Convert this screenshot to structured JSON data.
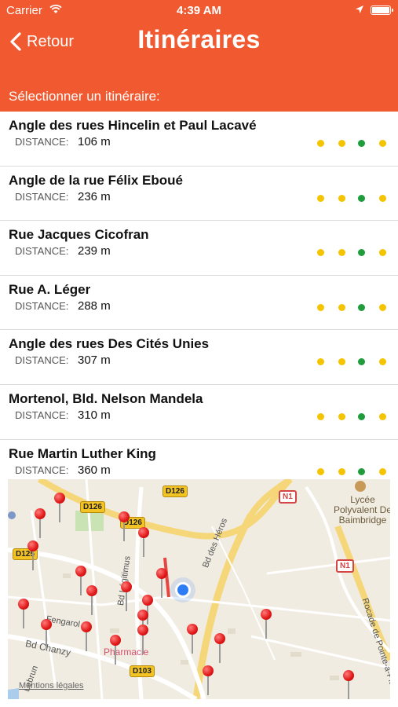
{
  "status_bar": {
    "carrier": "Carrier",
    "time": "4:39 AM"
  },
  "nav": {
    "back_label": "Retour",
    "title": "Itinéraires"
  },
  "section_label": "Sélectionner un itinéraire:",
  "list": {
    "distance_label": "DISTANCE:",
    "items": [
      {
        "title": "Angle des rues Hincelin et Paul Lacavé",
        "distance": "106 m",
        "dots": [
          "#f5c400",
          "#f5c400",
          "#1f9d3a",
          "#f5c400"
        ]
      },
      {
        "title": "Angle de la rue Félix Eboué",
        "distance": "236 m",
        "dots": [
          "#f5c400",
          "#f5c400",
          "#1f9d3a",
          "#f5c400"
        ]
      },
      {
        "title": "Rue Jacques Cicofran",
        "distance": "239 m",
        "dots": [
          "#f5c400",
          "#f5c400",
          "#1f9d3a",
          "#f5c400"
        ]
      },
      {
        "title": "Rue A. Léger",
        "distance": "288 m",
        "dots": [
          "#f5c400",
          "#f5c400",
          "#1f9d3a",
          "#f5c400"
        ]
      },
      {
        "title": "Angle des rues Des Cités Unies",
        "distance": "307 m",
        "dots": [
          "#f5c400",
          "#f5c400",
          "#1f9d3a",
          "#f5c400"
        ]
      },
      {
        "title": "Mortenol, Bld. Nelson Mandela",
        "distance": "310 m",
        "dots": [
          "#f5c400",
          "#f5c400",
          "#1f9d3a",
          "#f5c400"
        ]
      },
      {
        "title": "Rue Martin Luther King",
        "distance": "360 m",
        "dots": [
          "#f5c400",
          "#f5c400",
          "#1f9d3a",
          "#f5c400"
        ]
      }
    ]
  },
  "map": {
    "shields": [
      "D126",
      "D126",
      "D126",
      "D125",
      "D103"
    ],
    "n_shields": [
      "N1",
      "N1"
    ],
    "street_labels": [
      "Bd des Héros",
      "Bd Légitimus",
      "Bd Chanzy",
      "Rocade de Pointe-à-Pitre",
      "Fengarol",
      "Lebrun"
    ],
    "poi": {
      "name": "Lycée Polyvalent De Baimbridge"
    },
    "pharmacy": "Pharmacie",
    "legal": "Mentions légales"
  },
  "colors": {
    "accent": "#f15a30",
    "dot_yellow": "#f5c400",
    "dot_green": "#1f9d3a",
    "pin": "#e01616",
    "user_location": "#2f7df6"
  }
}
